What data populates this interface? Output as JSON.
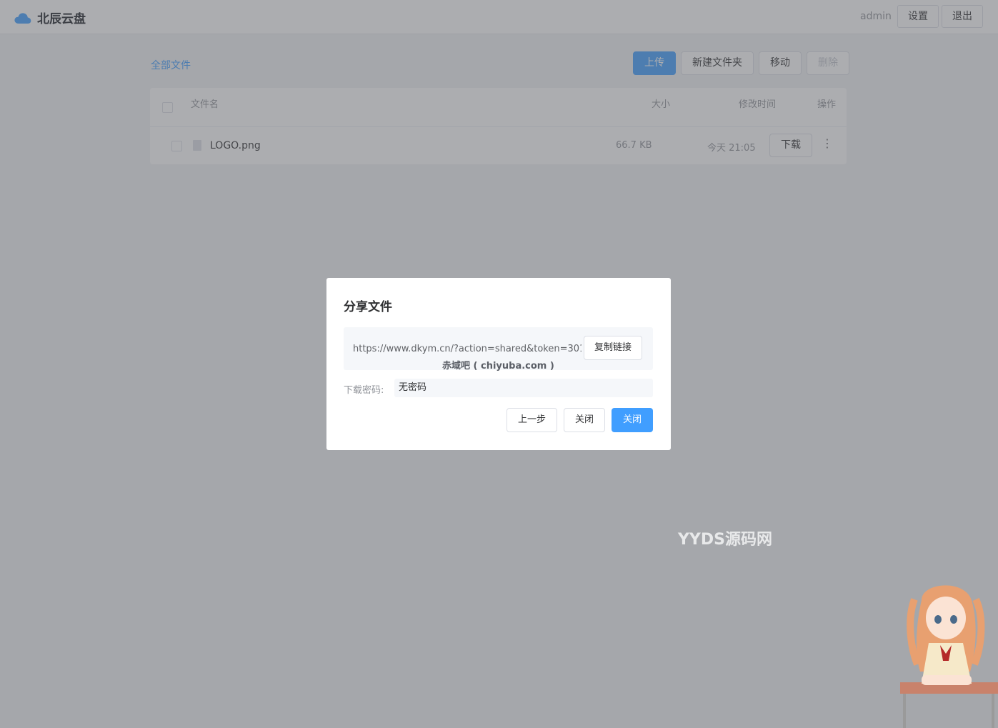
{
  "header": {
    "brand": "北辰云盘",
    "user": "admin",
    "settings_label": "设置",
    "logout_label": "退出"
  },
  "toolbar": {
    "breadcrumb": "全部文件",
    "upload_label": "上传",
    "new_folder_label": "新建文件夹",
    "move_label": "移动",
    "delete_label": "删除"
  },
  "table": {
    "columns": {
      "name": "文件名",
      "size": "大小",
      "modified": "修改时间",
      "actions": "操作"
    },
    "rows": [
      {
        "name": "LOGO.png",
        "size": "66.7 KB",
        "modified": "今天 21:05",
        "download_label": "下载",
        "more": "⋮"
      }
    ]
  },
  "dialog": {
    "title": "分享文件",
    "link": "https://www.dkym.cn/?action=shared&token=301...",
    "copy_label": "复制链接",
    "link_watermark": "赤域吧 ( chiyuba.com )",
    "password_label": "下载密码:",
    "password_value": "无密码",
    "prev_label": "上一步",
    "close_label": "关闭",
    "close_primary_label": "关闭"
  },
  "watermark": "YYDS源码网",
  "colors": {
    "primary": "#409eff",
    "overlay": "#5a5c62"
  }
}
